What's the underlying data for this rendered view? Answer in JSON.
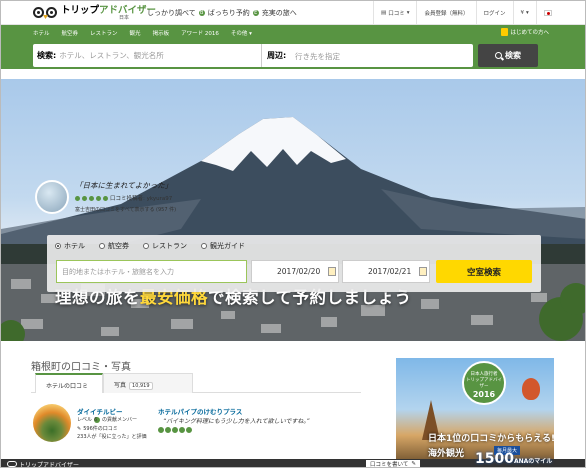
{
  "header": {
    "logo_text_a": "トリップ",
    "logo_text_b": "アドバイザー",
    "logo_region": "日本",
    "tagline_a": "しっかり調べて",
    "tagline_b": "ばっちり予約",
    "tagline_c": "充実の旅へ",
    "reviews_link": "口コミ",
    "signup_link": "会員登録（無料）",
    "login_link": "ログイン",
    "currency": "¥",
    "tagline_dot_b": "B",
    "tagline_dot_c": "E"
  },
  "nav": {
    "items": [
      "ホテル",
      "航空券",
      "レストラン",
      "観光",
      "掲示板",
      "アワード 2016",
      "その他"
    ],
    "beginner": "はじめての方へ"
  },
  "search": {
    "label": "検索:",
    "placeholder": "ホテル、レストラン、観光名所",
    "near_label": "周辺:",
    "near_placeholder": "行き先を指定",
    "button": "検索"
  },
  "hero": {
    "quote": "「日本に生まれてよかった」",
    "quote_user": "口コミ投稿者: ykyura97",
    "quote_source": "富士吉田の口コミをすべて表示する (957 件)",
    "title_a": "理想の旅を",
    "title_b": "最安価格",
    "title_c": "で",
    "title_d": "検索して予約",
    "title_e": "しましょう"
  },
  "booking": {
    "tabs": [
      "ホテル",
      "航空券",
      "レストラン",
      "観光ガイド"
    ],
    "selected_tab": "ホテル",
    "destination_placeholder": "目的地またはホテル・旅館名を入力",
    "checkin": "2017/02/20",
    "checkout": "2017/02/21",
    "button": "空室検索"
  },
  "lower": {
    "section_title": "箱根町の口コミ・写真",
    "tab_reviews": "ホテルの口コミ",
    "tab_photos": "写真",
    "photo_count": "10,919",
    "review": {
      "user": "ダイイチルビー",
      "level": "レベル",
      "level_num": "6",
      "badge_label": "の貢献メンバー",
      "review_count": "596件の口コミ",
      "helpful": "233人が「役に立った」と評価",
      "place": "ホテルパイプのけむりプラス",
      "quote": "“バイキング料理にもう少し力を入れて欲しいですね。”",
      "rating": 5
    }
  },
  "ad": {
    "badge_top": "日本人旅行者",
    "badge_brand": "トリップアドバイザー",
    "badge_year": "2016",
    "line1": "日本1位の口コミからもらえる!",
    "line2": "海外観光",
    "miles_label": "毎月最大",
    "miles": "1500",
    "miles_unit": "ANAのマイル"
  },
  "footer": {
    "brand": "トリップアドバイザー",
    "review_prompt": "口コミを書いて"
  }
}
